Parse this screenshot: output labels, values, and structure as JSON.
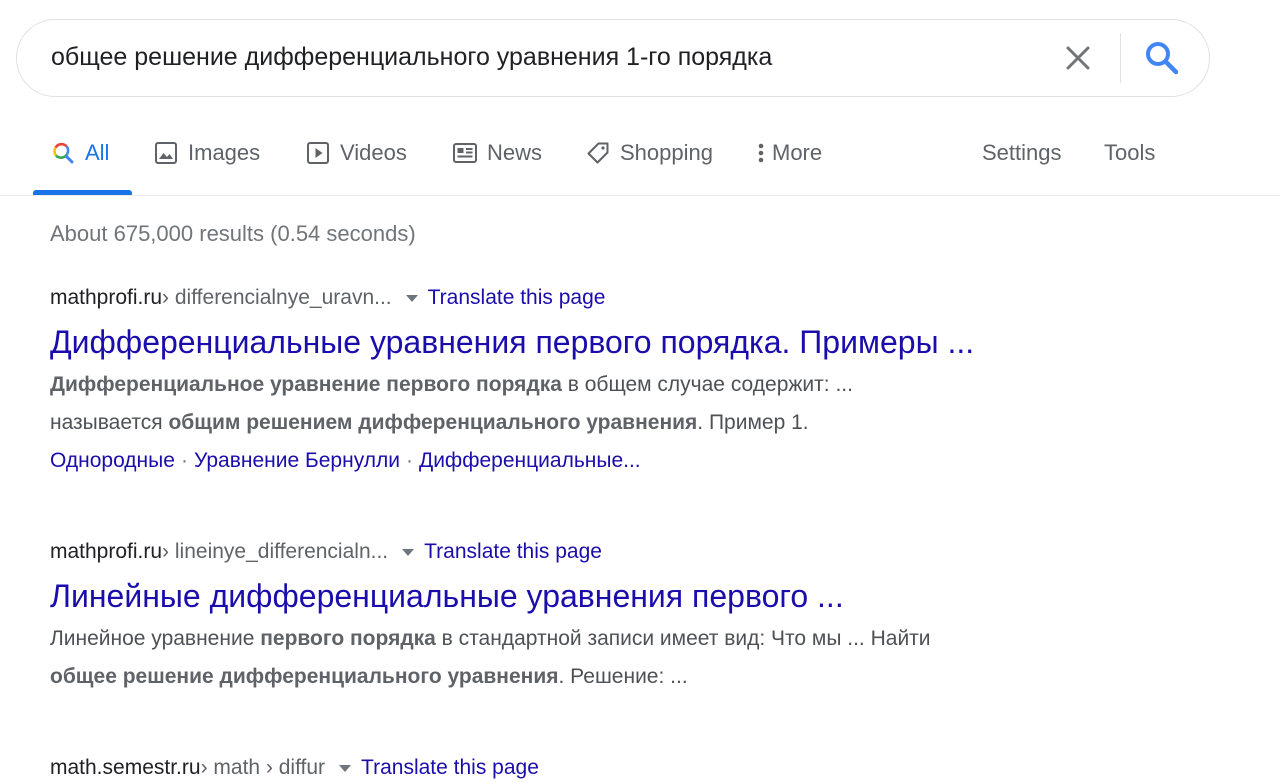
{
  "search": {
    "query": "общее решение дифференциального уравнения 1-го порядка"
  },
  "tabs": [
    {
      "label": "All",
      "icon": "search-icon"
    },
    {
      "label": "Images",
      "icon": "image-icon"
    },
    {
      "label": "Videos",
      "icon": "play-icon"
    },
    {
      "label": "News",
      "icon": "news-icon"
    },
    {
      "label": "Shopping",
      "icon": "tag-icon"
    },
    {
      "label": "More",
      "icon": "more-vert-icon"
    }
  ],
  "tools": {
    "settings": "Settings",
    "tools": "Tools"
  },
  "stats": "About 675,000 results (0.54 seconds)",
  "results": [
    {
      "domain": "mathprofi.ru",
      "path": " › differencialnye_uravn...",
      "translate": "Translate this page",
      "title": "Дифференциальные уравнения первого порядка. Примеры ...",
      "snippet": [
        [
          {
            "b": true,
            "t": "Дифференциальное уравнение первого порядка"
          },
          {
            "b": false,
            "t": " в общем случае содержит: ..."
          }
        ],
        [
          {
            "b": false,
            "t": "называется "
          },
          {
            "b": true,
            "t": "общим решением дифференциального уравнения"
          },
          {
            "b": false,
            "t": ". Пример 1."
          }
        ]
      ],
      "sitelinks": [
        "Однородные",
        "Уравнение Бернулли",
        "Дифференциальные..."
      ]
    },
    {
      "domain": "mathprofi.ru",
      "path": " › lineinye_differencialn...",
      "translate": "Translate this page",
      "title": "Линейные дифференциальные уравнения первого ...",
      "snippet": [
        [
          {
            "b": false,
            "t": "Линейное уравнение "
          },
          {
            "b": true,
            "t": "первого порядка"
          },
          {
            "b": false,
            "t": " в стандартной записи имеет вид: Что мы ... Найти"
          }
        ],
        [
          {
            "b": true,
            "t": "общее решение дифференциального уравнения"
          },
          {
            "b": false,
            "t": ". Решение: ..."
          }
        ]
      ],
      "sitelinks": []
    },
    {
      "domain": "math.semestr.ru",
      "path": " › math › diffur",
      "translate": "Translate this page",
      "title": "",
      "snippet": [],
      "sitelinks": []
    }
  ],
  "colors": {
    "accent": "#1a73e8",
    "link": "#1a0dab",
    "secondary_text": "#70757a"
  }
}
